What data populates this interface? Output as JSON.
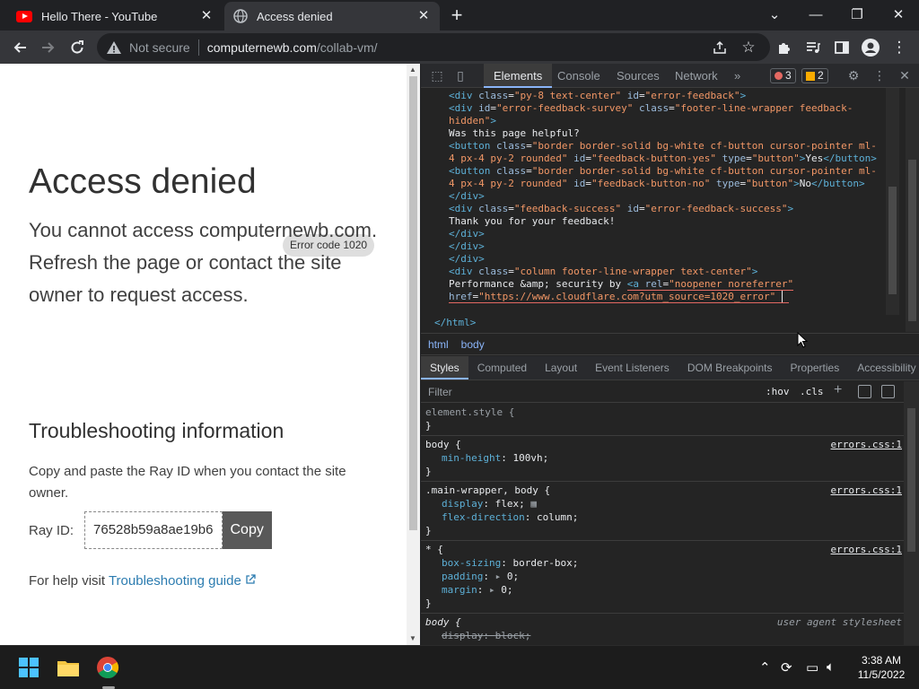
{
  "tabs": [
    {
      "title": "Hello There - YouTube",
      "icon": "youtube-icon"
    },
    {
      "title": "Access denied",
      "icon": "globe-icon"
    }
  ],
  "omnibox": {
    "security": "Not secure",
    "host": "computernewb.com",
    "path": "/collab-vm/"
  },
  "page": {
    "title": "Access denied",
    "error_code": "Error code 1020",
    "lead": "You cannot access computernewb.com. Refresh the page or contact the site owner to request access.",
    "troubleshooting_title": "Troubleshooting information",
    "instructions": "Copy and paste the Ray ID when you contact the site owner.",
    "ray_label": "Ray ID:",
    "ray_id": "76528b59a8ae19b6",
    "copy_label": "Copy",
    "help_prefix": "For help visit",
    "help_link": "Troubleshooting guide"
  },
  "devtools": {
    "tabs": [
      "Elements",
      "Console",
      "Sources",
      "Network"
    ],
    "more": "»",
    "errors": "3",
    "warnings": "2",
    "crumbs": [
      "html",
      "body"
    ],
    "sub_tabs": [
      "Styles",
      "Computed",
      "Layout",
      "Event Listeners",
      "DOM Breakpoints",
      "Properties",
      "Accessibility"
    ],
    "filter_placeholder": "Filter",
    "hov": ":hov",
    "cls": ".cls",
    "close_html": "</html>"
  },
  "styles": {
    "element_style": "element.style {",
    "body1_sel": "body {",
    "body1_src": "errors.css:1",
    "body1_prop": "min-height",
    "body1_val": "100vh;",
    "mw_sel": ".main-wrapper, body {",
    "mw_src": "errors.css:1",
    "mw_p1": "display",
    "mw_v1": "flex;",
    "mw_p2": "flex-direction",
    "mw_v2": "column;",
    "star_sel": "* {",
    "star_src": "errors.css:1",
    "star_p1": "box-sizing",
    "star_v1": "border-box;",
    "star_p2": "padding",
    "star_v2": "0;",
    "star_p3": "margin",
    "star_v3": "0;",
    "ua_sel": "body {",
    "ua_src": "user agent stylesheet",
    "ua_p1": "display",
    "ua_v1": "block;"
  },
  "taskbar": {
    "time": "3:38 AM",
    "date": "11/5/2022"
  }
}
